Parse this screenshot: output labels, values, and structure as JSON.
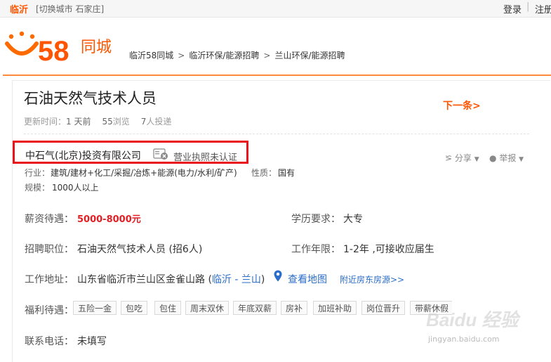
{
  "topbar": {
    "city": "临沂",
    "switch": "[切换城市 石家庄]",
    "login": "登录",
    "sep": "|",
    "register": "注册"
  },
  "logo": {
    "number": "58",
    "text": "同城",
    "icon": "smiley-logo-icon"
  },
  "breadcrumb": [
    "临沂58同城",
    "临沂环保/能源招聘",
    "兰山环保/能源招聘"
  ],
  "job": {
    "title": "石油天然气技术人员",
    "next": "下一条>",
    "meta": {
      "update_label": "更新时间：",
      "update_value": "1 天前",
      "views_value": "55",
      "views_label": "浏览",
      "applies_value": "7",
      "applies_label": "人投递"
    }
  },
  "company": {
    "name": "中石气(北京)投资有限公司",
    "license_status": "营业执照未认证",
    "industry_label": "行业：",
    "industry": "建筑/建材+化工/采掘/冶炼+能源(电力/水利/矿产)",
    "nature_label": "性质：",
    "nature": "国有",
    "size_label": "规模：",
    "size": "1000人以上"
  },
  "actions": {
    "share": "分享",
    "report": "举报"
  },
  "details": {
    "salary_label": "薪资待遇：",
    "salary": "5000-8000元",
    "edu_label": "学历要求：",
    "edu": "大专",
    "position_label": "招聘职位：",
    "position": "石油天然气技术人员 (招6人)",
    "exp_label": "工作年限：",
    "exp": "1-2年 ,可接收应届生",
    "addr_label": "工作地址：",
    "addr_prefix": "山东省临沂市兰山区金雀山路 (",
    "addr_link": "临沂 - 兰山",
    "addr_suffix": ")",
    "map_link": "查看地图",
    "nearby_link": "附近房东房源>>",
    "welfare_label": "福利待遇：",
    "welfare": [
      "五险一金",
      "包吃",
      "包住",
      "周末双休",
      "年底双薪",
      "房补",
      "加班补助",
      "岗位晋升",
      "带薪休假"
    ],
    "phone_label": "联系电话：",
    "phone": "未填写"
  },
  "watermark": {
    "text": "Baidu 经验",
    "url": "jingyan.baidu.com"
  },
  "colors": {
    "brand": "#ff5500",
    "salary": "#e21f25",
    "link": "#2b6dc8",
    "highlight": "#e8131b"
  }
}
